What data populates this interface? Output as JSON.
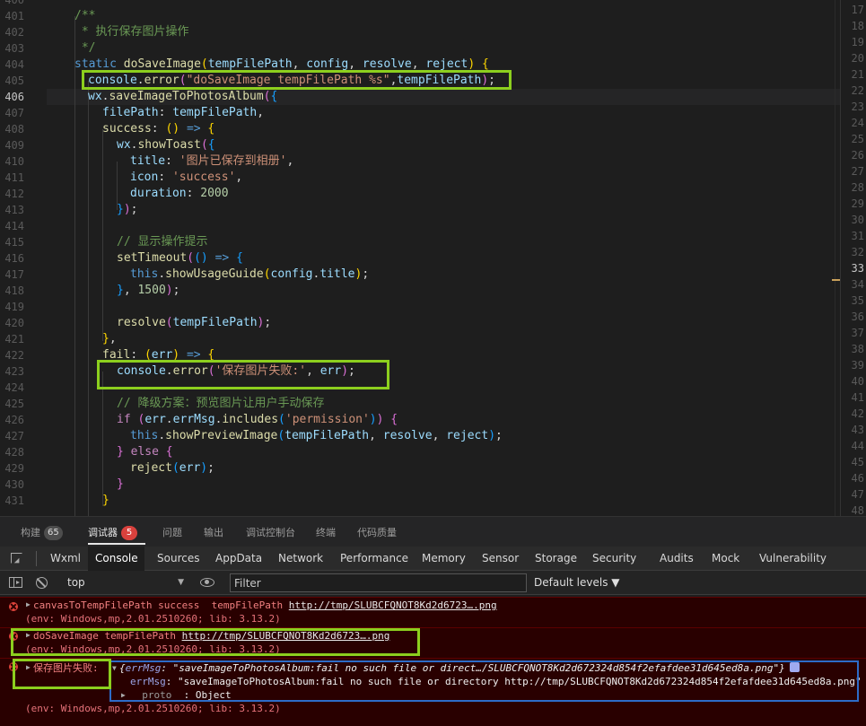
{
  "editor": {
    "gutter_lines": [
      "400",
      "401",
      "402",
      "403",
      "404",
      "405",
      "406",
      "407",
      "408",
      "409",
      "410",
      "411",
      "412",
      "413",
      "414",
      "415",
      "416",
      "417",
      "418",
      "419",
      "420",
      "421",
      "422",
      "423",
      "424",
      "425",
      "426",
      "427",
      "428",
      "429",
      "430",
      "431"
    ],
    "current_line": "406",
    "code": {
      "l401": "/**",
      "l402": " * 执行保存图片操作",
      "l403": " */",
      "l404_kw": "static",
      "l404_fn": "doSaveImage",
      "l404_p1": "tempFilePath",
      "l404_p2": "config",
      "l404_p3": "resolve",
      "l404_p4": "reject",
      "l405_obj": "console",
      "l405_fn": "error",
      "l405_str": "\"doSaveImage tempFilePath %s\"",
      "l405_arg": "tempFilePath",
      "l406_obj": "wx",
      "l406_fn": "saveImageToPhotosAlbum",
      "l407_key": "filePath",
      "l407_val": "tempFilePath",
      "l408_key": "success",
      "l409_obj": "wx",
      "l409_fn": "showToast",
      "l410_key": "title",
      "l410_val": "'图片已保存到相册'",
      "l411_key": "icon",
      "l411_val": "'success'",
      "l412_key": "duration",
      "l412_val": "2000",
      "l415": "// 显示操作提示",
      "l416_fn": "setTimeout",
      "l417_this": "this",
      "l417_fn": "showUsageGuide",
      "l417_arg1": "config",
      "l417_arg2": "title",
      "l418_num": "1500",
      "l420_fn": "resolve",
      "l420_arg": "tempFilePath",
      "l422_key": "fail",
      "l422_arg": "err",
      "l423_obj": "console",
      "l423_fn": "error",
      "l423_str": "'保存图片失败:'",
      "l423_arg": "err",
      "l425": "// 降级方案：预览图片让用户手动保存",
      "l426_kw": "if",
      "l426_a": "err",
      "l426_b": "errMsg",
      "l426_fn": "includes",
      "l426_str": "'permission'",
      "l427_this": "this",
      "l427_fn": "showPreviewImage",
      "l427_a1": "tempFilePath",
      "l427_a2": "resolve",
      "l427_a3": "reject",
      "l428_kw": "else",
      "l429_fn": "reject",
      "l429_arg": "err"
    },
    "split_lines": [
      "17",
      "18",
      "19",
      "20",
      "21",
      "22",
      "23",
      "24",
      "25",
      "26",
      "27",
      "28",
      "29",
      "30",
      "31",
      "32",
      "33",
      "34",
      "35",
      "36",
      "37",
      "38",
      "39",
      "40",
      "41",
      "42",
      "43",
      "44",
      "45",
      "46",
      "47",
      "48"
    ],
    "split_current": "33"
  },
  "panel_tabs": [
    {
      "label": "构建",
      "badge": "65",
      "badge_color": "#4d4d4d"
    },
    {
      "label": "调试器",
      "badge": "5",
      "badge_color": "#d9413d"
    },
    {
      "label": "问题"
    },
    {
      "label": "输出"
    },
    {
      "label": "调试控制台"
    },
    {
      "label": "终端"
    },
    {
      "label": "代码质量"
    }
  ],
  "devtools_tabs": [
    "Wxml",
    "Console",
    "Sources",
    "AppData",
    "Network",
    "Performance",
    "Memory",
    "Sensor",
    "Storage",
    "Security",
    "Audits",
    "Mock",
    "Vulnerability"
  ],
  "devtools_active": "Console",
  "console_toolbar": {
    "context": "top",
    "filter_placeholder": "Filter",
    "levels": "Default levels ▼"
  },
  "messages": {
    "m1_text": "canvasToTempFilePath success  tempFilePath ",
    "m1_url": "http://tmp/SLUBCFQNOT8Kd2d6723….png",
    "m1_env": "(env: Windows,mp,2.01.2510260; lib: 3.13.2)",
    "m2_text": "doSaveImage tempFilePath ",
    "m2_url": "http://tmp/SLUBCFQNOT8Kd2d6723….png",
    "m2_env": "(env: Windows,mp,2.01.2510260; lib: 3.13.2)",
    "m3_label": "保存图片失败:",
    "m3_obj_summary_key": "errMsg",
    "m3_obj_summary_val": "\"saveImageToPhotosAlbum:fail no such file or direct…/SLUBCFQNOT8Kd2d672324d854f2efafdee31d645ed8a.png\"",
    "m3_errmsg_key": "errMsg",
    "m3_errmsg_val": "\"saveImageToPhotosAlbum:fail no such file or directory http://tmp/SLUBCFQNOT8Kd2d672324d854f2efafdee31d645ed8a.png\"",
    "m3_proto_key": "__proto__",
    "m3_proto_val": "Object",
    "m3_env": "(env: Windows,mp,2.01.2510260; lib: 3.13.2)"
  },
  "colors": {
    "highlight_box": "#8ccf1e",
    "error_bg": "#290000",
    "badge_red": "#d9413d"
  }
}
